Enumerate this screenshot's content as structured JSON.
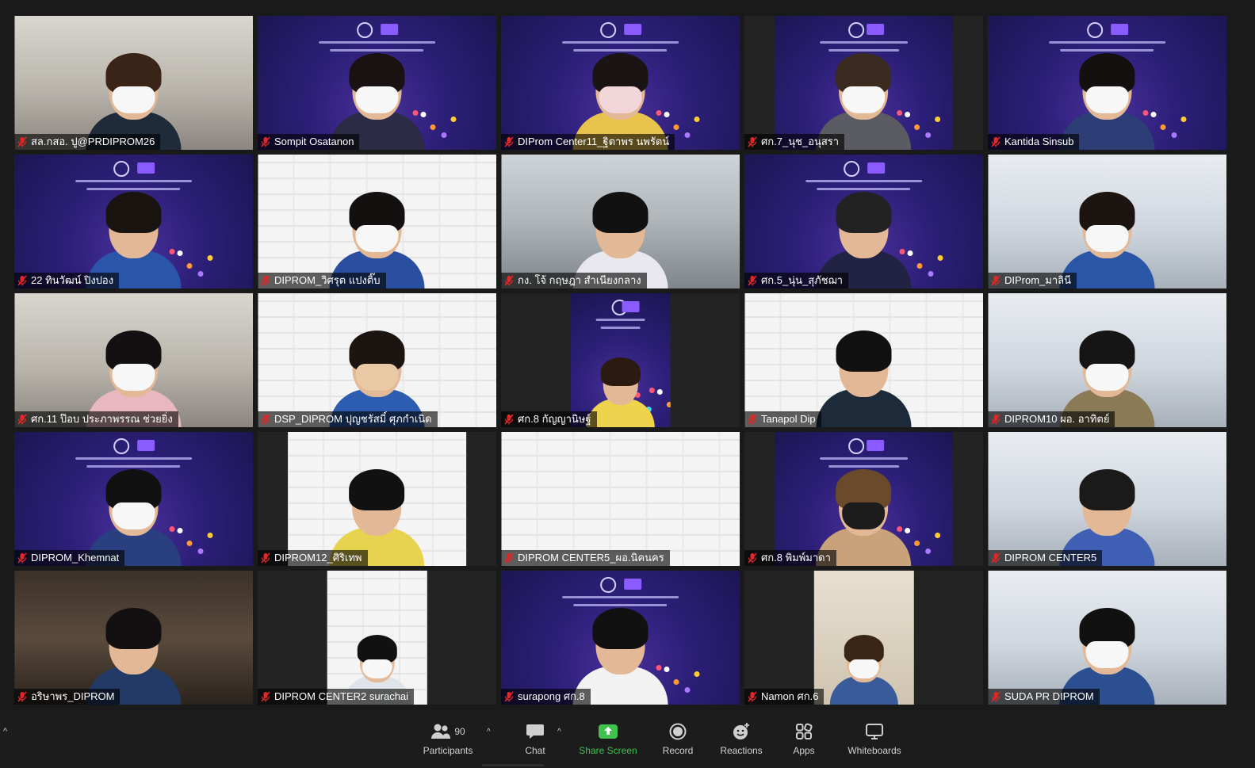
{
  "participants": [
    {
      "name": "สล.กสอ. ปู@PRDIPROM26",
      "bg": "office",
      "feed": "full",
      "shirt": "#1f2b3a",
      "hair": "#3a2418",
      "mask": "white"
    },
    {
      "name": "Sompit Osatanon",
      "bg": "stage",
      "feed": "full",
      "shirt": "#2b2b45",
      "hair": "#1a1212",
      "mask": "white"
    },
    {
      "name": "DIProm Center11_ฐิตาพร นพรัตน์",
      "bg": "stage",
      "feed": "full",
      "shirt": "#e8c24a",
      "hair": "#1b1414",
      "mask": "pink"
    },
    {
      "name": "ศก.7_นุช_อนุสรา",
      "bg": "stage",
      "feed": "med",
      "shirt": "#5b5b63",
      "hair": "#3a2a20",
      "mask": "white"
    },
    {
      "name": "Kantida Sinsub",
      "bg": "stage",
      "feed": "full",
      "shirt": "#2c3e75",
      "hair": "#141010",
      "mask": "white"
    },
    {
      "name": "22 ทินวัฒน์ ปิงปอง",
      "bg": "stage",
      "feed": "full",
      "shirt": "#2a55a8",
      "hair": "#1a1410",
      "mask": "none"
    },
    {
      "name": "DIPROM_วิศรุต แปงติ๊บ",
      "bg": "pattern",
      "feed": "full",
      "shirt": "#2a4fa0",
      "hair": "#141010",
      "mask": "white"
    },
    {
      "name": "กง. โจ้ กฤษฎา สำเนียงกลาง",
      "bg": "room",
      "feed": "full",
      "shirt": "#e8e8ee",
      "hair": "#111111",
      "mask": "none"
    },
    {
      "name": "ศก.5_นุ่น_สุภัชฌา",
      "bg": "stage",
      "feed": "full",
      "shirt": "#222244",
      "hair": "#222222",
      "mask": "none"
    },
    {
      "name": "DIProm_มาลินี",
      "bg": "meeting",
      "feed": "full",
      "shirt": "#2b55a5",
      "hair": "#1c1410",
      "mask": "white"
    },
    {
      "name": "ศก.11 ป๊อบ ประภาพรรณ ช่วยยิ่ง",
      "bg": "office",
      "feed": "full",
      "shirt": "#e9b7bf",
      "hair": "#121010",
      "mask": "white"
    },
    {
      "name": "DSP_DIPROM ปุญชรัสมิ์ ศุภกำเนิด",
      "bg": "pattern",
      "feed": "full",
      "shirt": "#2d5db0",
      "hair": "#1b1410",
      "mask": "beige"
    },
    {
      "name": "ศก.8 กัญญานิษฐ์",
      "bg": "stage",
      "feed": "narrow",
      "shirt": "#efd34c",
      "hair": "#2a1a10",
      "mask": "none"
    },
    {
      "name": "Tanapol Dip",
      "bg": "pattern",
      "feed": "full",
      "shirt": "#1c2a3a",
      "hair": "#111111",
      "mask": "none"
    },
    {
      "name": "DIPROM10 ผอ. อาทิตย์",
      "bg": "meeting",
      "feed": "full",
      "shirt": "#8a7a55",
      "hair": "#151515",
      "mask": "white"
    },
    {
      "name": "DIPROM_Khemnat",
      "bg": "stage",
      "feed": "full",
      "shirt": "#2a3f80",
      "hair": "#111111",
      "mask": "white"
    },
    {
      "name": "DIPROM12_ศิริเทพ",
      "bg": "pattern",
      "feed": "med",
      "shirt": "#e8d34e",
      "hair": "#111111",
      "mask": "none"
    },
    {
      "name": "DIPROM CENTER5_ผอ.นิคนคร",
      "bg": "pattern",
      "feed": "full",
      "shirt": "#f4f4f4",
      "hair": "#f4f4f4",
      "mask": "none"
    },
    {
      "name": "ศก.8 พิมพ์มาดา",
      "bg": "stage",
      "feed": "med",
      "shirt": "#c9a27a",
      "hair": "#6b4a2c",
      "mask": "dark"
    },
    {
      "name": "DIPROM CENTER5",
      "bg": "meeting",
      "feed": "full",
      "shirt": "#3f5fb5",
      "hair": "#1a1a1a",
      "mask": "none"
    },
    {
      "name": "อริษาพร_DIPROM",
      "bg": "dark",
      "feed": "full",
      "shirt": "#243a66",
      "hair": "#121010",
      "mask": "none"
    },
    {
      "name": "DIPROM CENTER2 surachai",
      "bg": "pattern",
      "feed": "narrow",
      "shirt": "#dfe4ea",
      "hair": "#111111",
      "mask": "white"
    },
    {
      "name": "surapong ศก.8",
      "bg": "stage",
      "feed": "full",
      "shirt": "#f2f2f2",
      "hair": "#111111",
      "mask": "none"
    },
    {
      "name": "Namon ศก.6",
      "bg": "beige",
      "feed": "narrow",
      "shirt": "#3a5b9a",
      "hair": "#3a2616",
      "mask": "white"
    },
    {
      "name": "SUDA PR DIPROM",
      "bg": "meeting",
      "feed": "full",
      "shirt": "#2c4f92",
      "hair": "#111111",
      "mask": "white"
    }
  ],
  "toolbar": {
    "participants_label": "Participants",
    "participants_count": "90",
    "chat_label": "Chat",
    "share_label": "Share Screen",
    "record_label": "Record",
    "reactions_label": "Reactions",
    "apps_label": "Apps",
    "whiteboards_label": "Whiteboards"
  },
  "colors": {
    "share_green": "#40c24f",
    "muted_red": "#e02828",
    "stage_purple": "#2c1f78"
  },
  "icons": [
    "mic-off-icon",
    "participants-icon",
    "chat-icon",
    "share-screen-icon",
    "record-icon",
    "reactions-icon",
    "apps-icon",
    "whiteboards-icon",
    "chevron-up-icon"
  ]
}
